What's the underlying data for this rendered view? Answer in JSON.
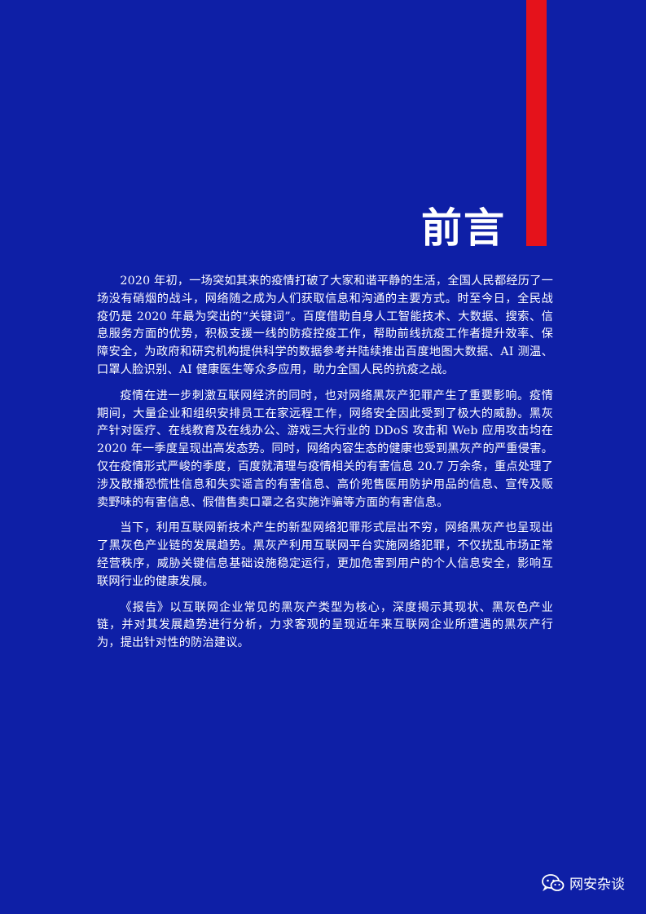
{
  "heading": "前言",
  "paragraphs": [
    "2020 年初，一场突如其来的疫情打破了大家和谐平静的生活，全国人民都经历了一场没有硝烟的战斗，网络随之成为人们获取信息和沟通的主要方式。时至今日，全民战疫仍是 2020 年最为突出的“关键词”。百度借助自身人工智能技术、大数据、搜索、信息服务方面的优势，积极支援一线的防疫控疫工作，帮助前线抗疫工作者提升效率、保障安全，为政府和研究机构提供科学的数据参考并陆续推出百度地图大数据、AI 测温、口罩人脸识别、AI 健康医生等众多应用，助力全国人民的抗疫之战。",
    "疫情在进一步刺激互联网经济的同时，也对网络黑灰产犯罪产生了重要影响。疫情期间，大量企业和组织安排员工在家远程工作，网络安全因此受到了极大的威胁。黑灰产针对医疗、在线教育及在线办公、游戏三大行业的 DDoS 攻击和 Web 应用攻击均在 2020 年一季度呈现出高发态势。同时，网络内容生态的健康也受到黑灰产的严重侵害。仅在疫情形式严峻的季度，百度就清理与疫情相关的有害信息 20.7 万余条，重点处理了涉及散播恐慌性信息和失实谣言的有害信息、高价兜售医用防护用品的信息、宣传及贩卖野味的有害信息、假借售卖口罩之名实施诈骗等方面的有害信息。",
    "当下，利用互联网新技术产生的新型网络犯罪形式层出不穷，网络黑灰产也呈现出了黑灰色产业链的发展趋势。黑灰产利用互联网平台实施网络犯罪，不仅扰乱市场正常经营秩序，威胁关键信息基础设施稳定运行，更加危害到用户的个人信息安全，影响互联网行业的健康发展。",
    "《报告》以互联网企业常见的黑灰产类型为核心，深度揭示其现状、黑灰色产业链，并对其发展趋势进行分析，力求客观的呈现近年来互联网企业所遭遇的黑灰产行为，提出针对性的防治建议。"
  ],
  "watermark": {
    "icon": "wechat-icon",
    "text": "网安杂谈"
  },
  "colors": {
    "background": "#0e1fa6",
    "accent_bar": "#e5121b",
    "text": "#ffffff"
  }
}
